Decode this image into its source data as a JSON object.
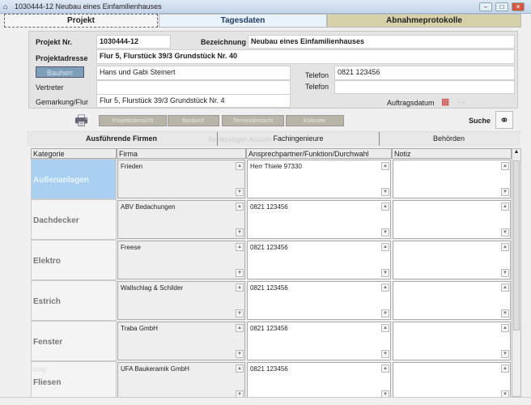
{
  "window": {
    "title": "1030444-12 Neubau eines Einfamilienhauses"
  },
  "main_tabs": [
    "Projekt",
    "Tagesdaten",
    "Abnahmeprotokolle"
  ],
  "project": {
    "nr_label": "Projekt Nr.",
    "nr": "1030444-12",
    "bez_label": "Bezeichnung",
    "bez": "Neubau eines Einfamilienhauses",
    "addr_label": "Projektadresse",
    "addr": "Flur 5, Flurstück 39/3  Grundstück Nr. 40",
    "bauherr_btn": "Bauherr",
    "bauherr": "Hans und Gabi Steinert",
    "vertreter_label": "Vertreter",
    "vertreter": "",
    "gemarkung_label": "Gemarkung/Flur",
    "gemarkung": "Flur 5, Flurstück 39/3  Grundstück Nr. 4",
    "tel_label": "Telefon",
    "tel1": "0821 123456",
    "tel2": "",
    "auftrag_label": "Auftragsdatum",
    "auftrag": "- -"
  },
  "toolbar": {
    "buttons": [
      "Projektübersicht",
      "Baubuch",
      "Terminübersicht",
      "Kalender"
    ],
    "search_label": "Suche"
  },
  "sub_tabs": [
    "Ausführende Firmen",
    "Fachingenieure",
    "Behörden"
  ],
  "ghost_text": "Rechtzeitigen Ausschr",
  "ghost_blog": "blog",
  "table": {
    "columns": [
      "Kategorie",
      "Firma",
      "Ansprechpartner/Funktion/Durchwahl",
      "Notiz"
    ],
    "rows": [
      {
        "kategorie": "Außenanlagen",
        "firma": "Frieden",
        "kontakt": "Herr Thiele  97330",
        "notiz": ""
      },
      {
        "kategorie": "Dachdecker",
        "firma": "ABV Bedachungen",
        "kontakt": "0821 123456",
        "notiz": ""
      },
      {
        "kategorie": "Elektro",
        "firma": "Freese",
        "kontakt": "0821 123456",
        "notiz": ""
      },
      {
        "kategorie": "Estrich",
        "firma": "Wallschlag & Schilder",
        "kontakt": "0821 123456",
        "notiz": ""
      },
      {
        "kategorie": "Fenster",
        "firma": "Traba GmbH",
        "kontakt": "0821 123456",
        "notiz": ""
      },
      {
        "kategorie": "Fliesen",
        "firma": "UFA Baukeramik GmbH",
        "kontakt": "0821 123456",
        "notiz": ""
      }
    ]
  }
}
